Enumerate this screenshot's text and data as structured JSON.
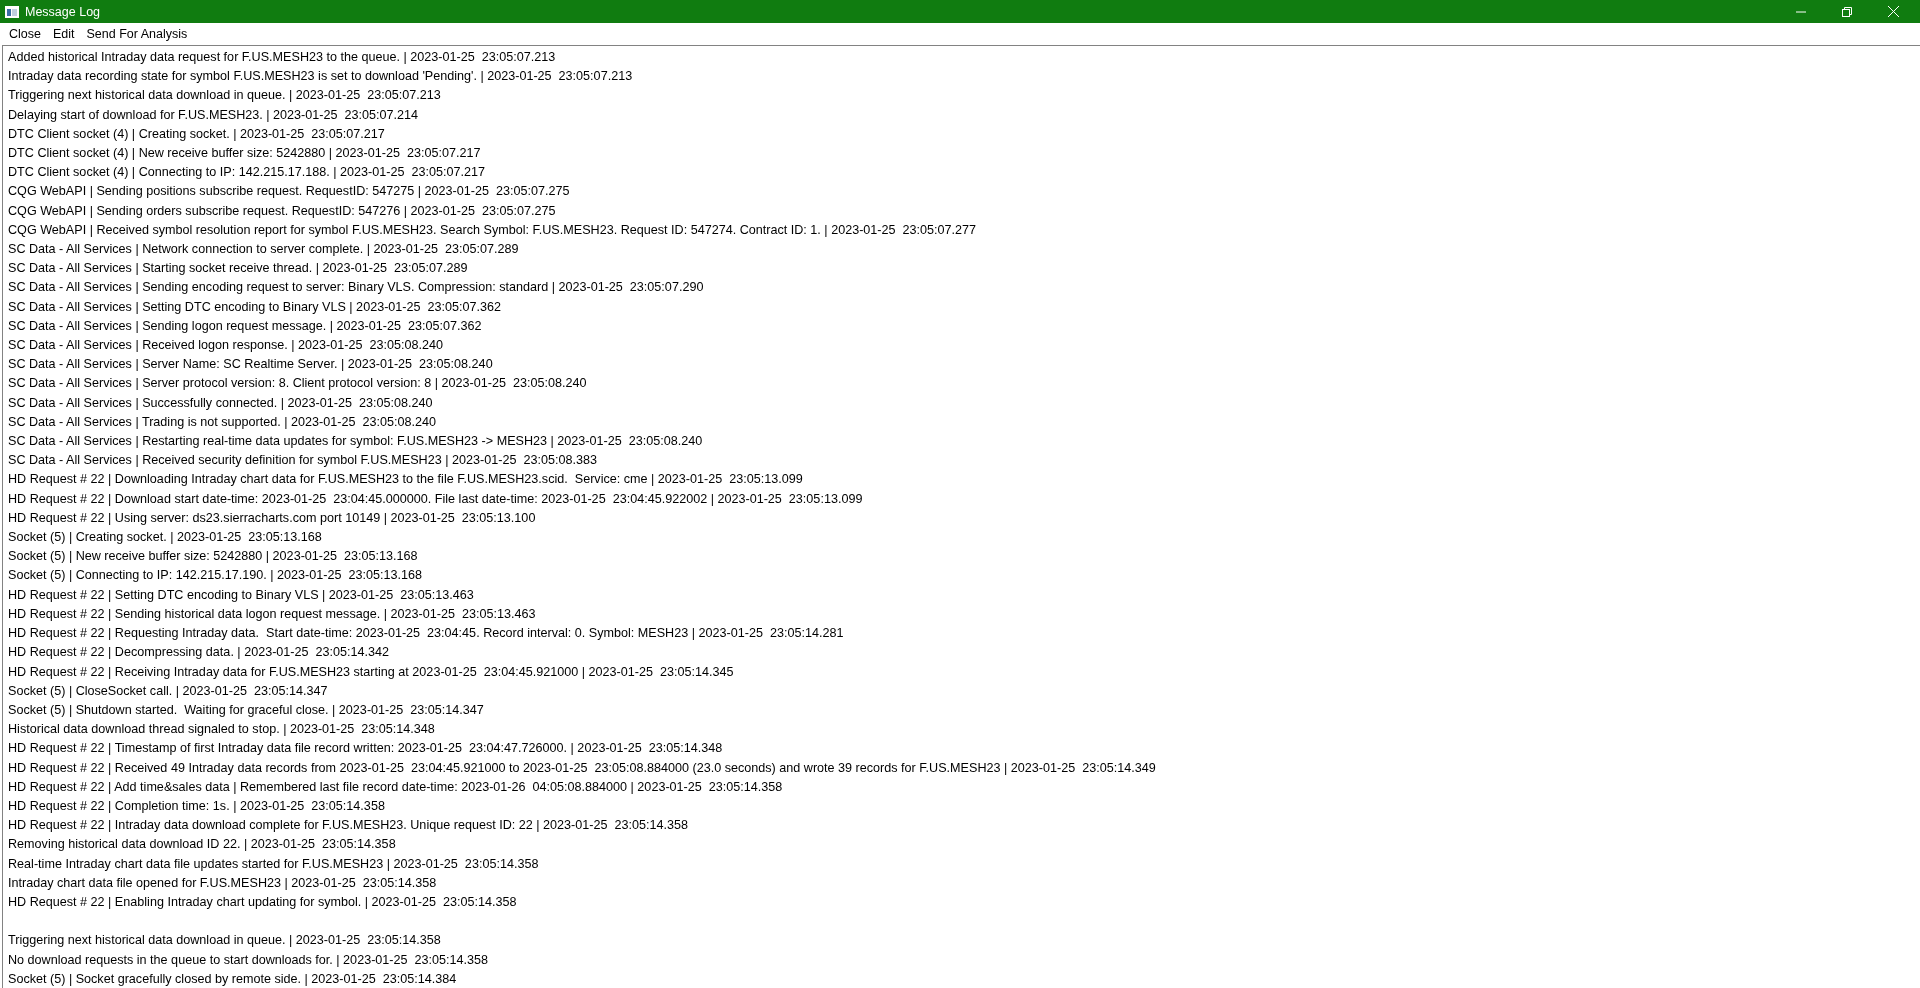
{
  "window": {
    "title": "Message Log"
  },
  "menu": [
    "Close",
    "Edit",
    "Send For Analysis"
  ],
  "log": {
    "blocks": [
      [
        "Added historical Intraday data request for F.US.MESH23 to the queue. | 2023-01-25  23:05:07.213",
        "Intraday data recording state for symbol F.US.MESH23 is set to download 'Pending'. | 2023-01-25  23:05:07.213",
        "Triggering next historical data download in queue. | 2023-01-25  23:05:07.213",
        "Delaying start of download for F.US.MESH23. | 2023-01-25  23:05:07.214",
        "DTC Client socket (4) | Creating socket. | 2023-01-25  23:05:07.217",
        "DTC Client socket (4) | New receive buffer size: 5242880 | 2023-01-25  23:05:07.217",
        "DTC Client socket (4) | Connecting to IP: 142.215.17.188. | 2023-01-25  23:05:07.217",
        "CQG WebAPI | Sending positions subscribe request. RequestID: 547275 | 2023-01-25  23:05:07.275",
        "CQG WebAPI | Sending orders subscribe request. RequestID: 547276 | 2023-01-25  23:05:07.275",
        "CQG WebAPI | Received symbol resolution report for symbol F.US.MESH23. Search Symbol: F.US.MESH23. Request ID: 547274. Contract ID: 1. | 2023-01-25  23:05:07.277",
        "SC Data - All Services | Network connection to server complete. | 2023-01-25  23:05:07.289",
        "SC Data - All Services | Starting socket receive thread. | 2023-01-25  23:05:07.289",
        "SC Data - All Services | Sending encoding request to server: Binary VLS. Compression: standard | 2023-01-25  23:05:07.290",
        "SC Data - All Services | Setting DTC encoding to Binary VLS | 2023-01-25  23:05:07.362",
        "SC Data - All Services | Sending logon request message. | 2023-01-25  23:05:07.362",
        "SC Data - All Services | Received logon response. | 2023-01-25  23:05:08.240",
        "SC Data - All Services | Server Name: SC Realtime Server. | 2023-01-25  23:05:08.240",
        "SC Data - All Services | Server protocol version: 8. Client protocol version: 8 | 2023-01-25  23:05:08.240",
        "SC Data - All Services | Successfully connected. | 2023-01-25  23:05:08.240",
        "SC Data - All Services | Trading is not supported. | 2023-01-25  23:05:08.240",
        "SC Data - All Services | Restarting real-time data updates for symbol: F.US.MESH23 -> MESH23 | 2023-01-25  23:05:08.240",
        "SC Data - All Services | Received security definition for symbol F.US.MESH23 | 2023-01-25  23:05:08.383",
        "HD Request # 22 | Downloading Intraday chart data for F.US.MESH23 to the file F.US.MESH23.scid.  Service: cme | 2023-01-25  23:05:13.099",
        "HD Request # 22 | Download start date-time: 2023-01-25  23:04:45.000000. File last date-time: 2023-01-25  23:04:45.922002 | 2023-01-25  23:05:13.099",
        "HD Request # 22 | Using server: ds23.sierracharts.com port 10149 | 2023-01-25  23:05:13.100",
        "Socket (5) | Creating socket. | 2023-01-25  23:05:13.168",
        "Socket (5) | New receive buffer size: 5242880 | 2023-01-25  23:05:13.168",
        "Socket (5) | Connecting to IP: 142.215.17.190. | 2023-01-25  23:05:13.168",
        "HD Request # 22 | Setting DTC encoding to Binary VLS | 2023-01-25  23:05:13.463",
        "HD Request # 22 | Sending historical data logon request message. | 2023-01-25  23:05:13.463",
        "HD Request # 22 | Requesting Intraday data.  Start date-time: 2023-01-25  23:04:45. Record interval: 0. Symbol: MESH23 | 2023-01-25  23:05:14.281",
        "HD Request # 22 | Decompressing data. | 2023-01-25  23:05:14.342",
        "HD Request # 22 | Receiving Intraday data for F.US.MESH23 starting at 2023-01-25  23:04:45.921000 | 2023-01-25  23:05:14.345",
        "Socket (5) | CloseSocket call. | 2023-01-25  23:05:14.347",
        "Socket (5) | Shutdown started.  Waiting for graceful close. | 2023-01-25  23:05:14.347",
        "Historical data download thread signaled to stop. | 2023-01-25  23:05:14.348",
        "HD Request # 22 | Timestamp of first Intraday data file record written: 2023-01-25  23:04:47.726000. | 2023-01-25  23:05:14.348",
        "HD Request # 22 | Received 49 Intraday data records from 2023-01-25  23:04:45.921000 to 2023-01-25  23:05:08.884000 (23.0 seconds) and wrote 39 records for F.US.MESH23 | 2023-01-25  23:05:14.349",
        "HD Request # 22 | Add time&sales data | Remembered last file record date-time: 2023-01-26  04:05:08.884000 | 2023-01-25  23:05:14.358",
        "HD Request # 22 | Completion time: 1s. | 2023-01-25  23:05:14.358",
        "HD Request # 22 | Intraday data download complete for F.US.MESH23. Unique request ID: 22 | 2023-01-25  23:05:14.358",
        "Removing historical data download ID 22. | 2023-01-25  23:05:14.358",
        "Real-time Intraday chart data file updates started for F.US.MESH23 | 2023-01-25  23:05:14.358",
        "Intraday chart data file opened for F.US.MESH23 | 2023-01-25  23:05:14.358",
        "HD Request # 22 | Enabling Intraday chart updating for symbol. | 2023-01-25  23:05:14.358"
      ],
      [
        "Triggering next historical data download in queue. | 2023-01-25  23:05:14.358",
        "No download requests in the queue to start downloads for. | 2023-01-25  23:05:14.358",
        "Socket (5) | Socket gracefully closed by remote side. | 2023-01-25  23:05:14.384"
      ]
    ]
  }
}
